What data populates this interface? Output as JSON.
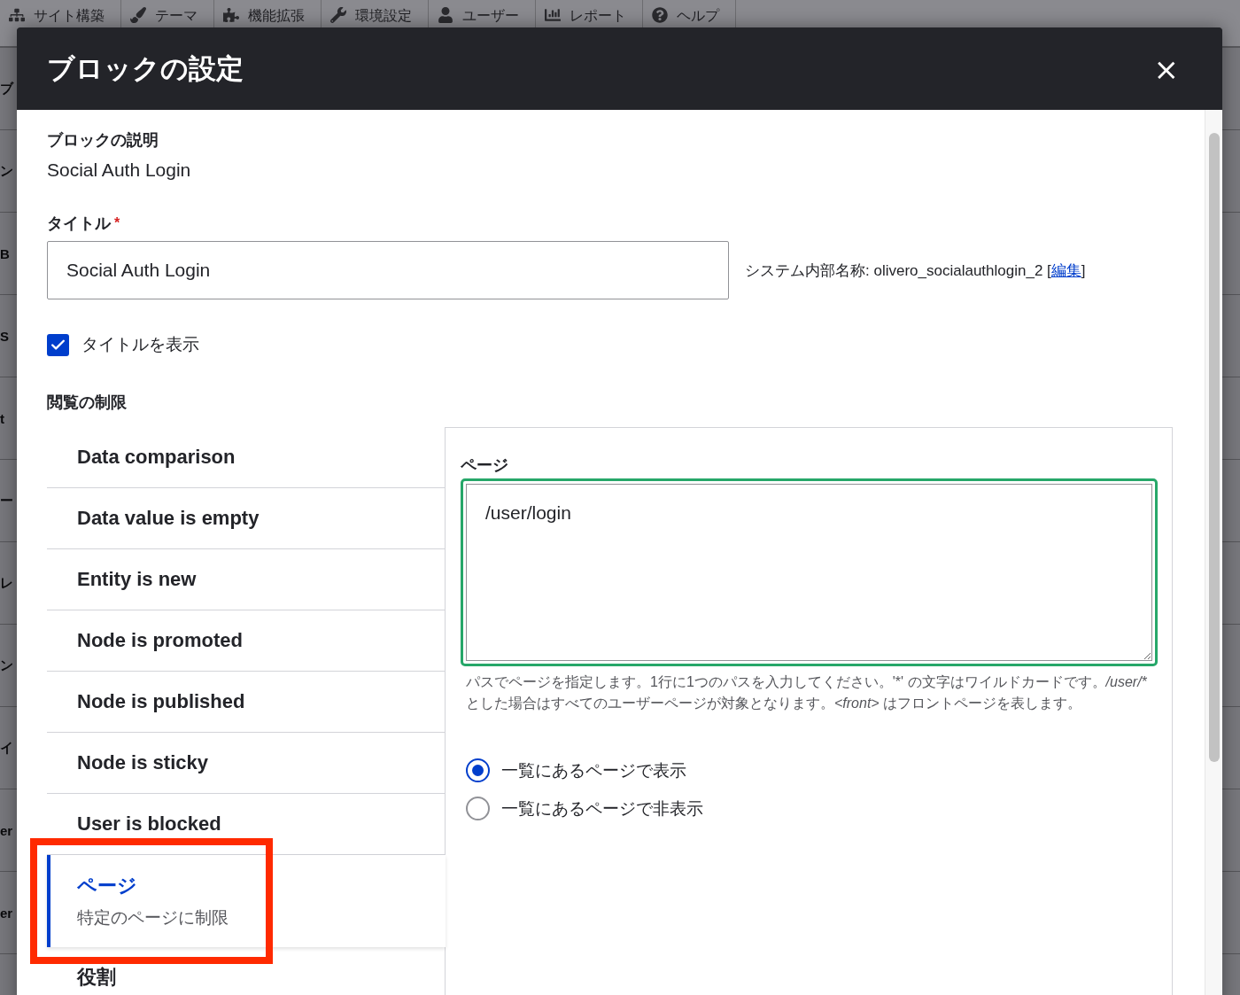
{
  "toolbar": {
    "items": [
      {
        "label": "サイト構築"
      },
      {
        "label": "テーマ"
      },
      {
        "label": "機能拡張"
      },
      {
        "label": "環境設定"
      },
      {
        "label": "ユーザー"
      },
      {
        "label": "レポート"
      },
      {
        "label": "ヘルプ"
      }
    ]
  },
  "background_fragments": [
    "ブ",
    "ン",
    "B",
    "S",
    "t",
    "ー",
    "レ",
    "ン",
    "イ",
    "er",
    "er"
  ],
  "dialog": {
    "title": "ブロックの設定",
    "close": "×",
    "description_label": "ブロックの説明",
    "description_value": "Social Auth Login",
    "title_field": {
      "label": "タイトル",
      "required_mark": "*",
      "value": "Social Auth Login",
      "machine_name": "システム内部名称: olivero_socialauthlogin_2",
      "link_open": "[",
      "machine_name_link": "編集",
      "link_close": "]"
    },
    "display_title": {
      "label": "タイトルを表示",
      "checked": true
    },
    "visibility_label": "閲覧の制限",
    "tabs": [
      {
        "title": "Data comparison",
        "selected": false
      },
      {
        "title": "Data value is empty",
        "selected": false
      },
      {
        "title": "Entity is new",
        "selected": false
      },
      {
        "title": "Node is promoted",
        "selected": false
      },
      {
        "title": "Node is published",
        "selected": false
      },
      {
        "title": "Node is sticky",
        "selected": false
      },
      {
        "title": "User is blocked",
        "selected": false
      },
      {
        "title": "ページ",
        "summary": "特定のページに制限",
        "selected": true,
        "highlighted": true
      },
      {
        "title": "役割",
        "selected": false
      }
    ],
    "pages_panel": {
      "label": "ページ",
      "value": "/user/login",
      "description": [
        {
          "text": "パスでページを指定します。1行に1つのパスを入力してください。'*' の文字はワイルドカードです。",
          "italic": false
        },
        {
          "text": "/user/*",
          "italic": true
        },
        {
          "text": " とした場合はすべてのユーザーページが対象となります。",
          "italic": false
        },
        {
          "text": "<front>",
          "italic": true
        },
        {
          "text": " はフロントページを表します。",
          "italic": false
        }
      ],
      "options": [
        {
          "label": "一覧にあるページで表示",
          "selected": true
        },
        {
          "label": "一覧にあるページで非表示",
          "selected": false
        }
      ]
    }
  }
}
